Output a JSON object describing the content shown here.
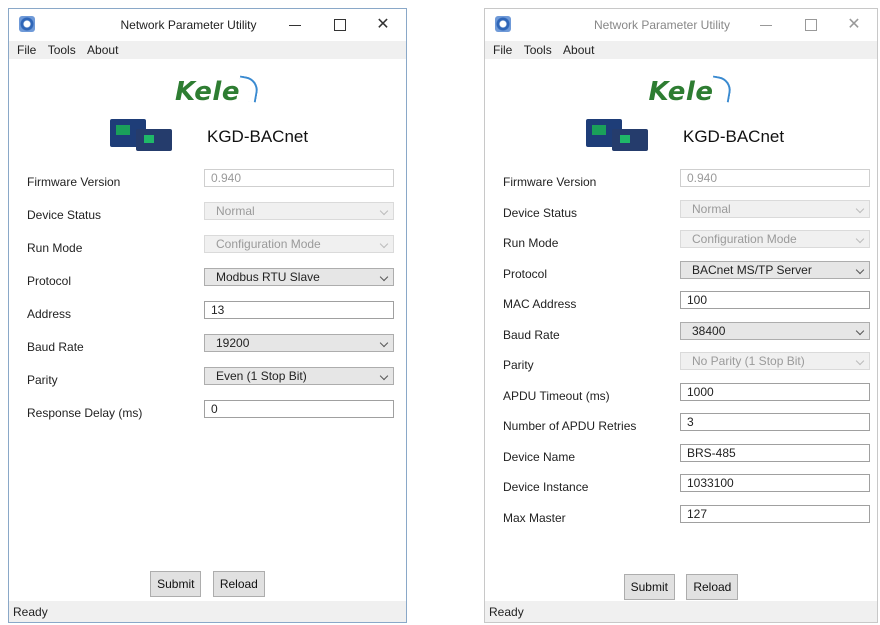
{
  "windows": [
    {
      "title": "Network Parameter Utility",
      "menu": [
        "File",
        "Tools",
        "About"
      ],
      "logo_text": "Kele",
      "device_name": "KGD-BACnet",
      "fields": [
        {
          "label": "Firmware Version",
          "value": "0.940",
          "kind": "text",
          "disabled": true
        },
        {
          "label": "Device Status",
          "value": "Normal",
          "kind": "select",
          "disabled": true
        },
        {
          "label": "Run Mode",
          "value": "Configuration Mode",
          "kind": "select",
          "disabled": true
        },
        {
          "label": "Protocol",
          "value": "Modbus RTU Slave",
          "kind": "select",
          "disabled": false
        },
        {
          "label": "Address",
          "value": "13",
          "kind": "text",
          "disabled": false
        },
        {
          "label": "Baud Rate",
          "value": "19200",
          "kind": "select",
          "disabled": false
        },
        {
          "label": "Parity",
          "value": "Even (1 Stop Bit)",
          "kind": "select",
          "disabled": false
        },
        {
          "label": "Response Delay (ms)",
          "value": "0",
          "kind": "text",
          "disabled": false
        }
      ],
      "buttons": {
        "submit": "Submit",
        "reload": "Reload"
      },
      "status": "Ready"
    },
    {
      "title": "Network Parameter Utility",
      "menu": [
        "File",
        "Tools",
        "About"
      ],
      "logo_text": "Kele",
      "device_name": "KGD-BACnet",
      "fields": [
        {
          "label": "Firmware Version",
          "value": "0.940",
          "kind": "text",
          "disabled": true
        },
        {
          "label": "Device Status",
          "value": "Normal",
          "kind": "select",
          "disabled": true
        },
        {
          "label": "Run Mode",
          "value": "Configuration Mode",
          "kind": "select",
          "disabled": true
        },
        {
          "label": "Protocol",
          "value": "BACnet MS/TP Server",
          "kind": "select",
          "disabled": false
        },
        {
          "label": "MAC Address",
          "value": "100",
          "kind": "text",
          "disabled": false
        },
        {
          "label": "Baud Rate",
          "value": "38400",
          "kind": "select",
          "disabled": false
        },
        {
          "label": "Parity",
          "value": "No Parity (1 Stop Bit)",
          "kind": "select",
          "disabled": true
        },
        {
          "label": "APDU Timeout (ms)",
          "value": "1000",
          "kind": "text",
          "disabled": false
        },
        {
          "label": "Number of APDU Retries",
          "value": "3",
          "kind": "text",
          "disabled": false
        },
        {
          "label": "Device Name",
          "value": "BRS-485",
          "kind": "text",
          "disabled": false
        },
        {
          "label": "Device Instance",
          "value": "1033100",
          "kind": "text",
          "disabled": false
        },
        {
          "label": "Max Master",
          "value": "127",
          "kind": "text",
          "disabled": false
        }
      ],
      "buttons": {
        "submit": "Submit",
        "reload": "Reload"
      },
      "status": "Ready"
    }
  ]
}
